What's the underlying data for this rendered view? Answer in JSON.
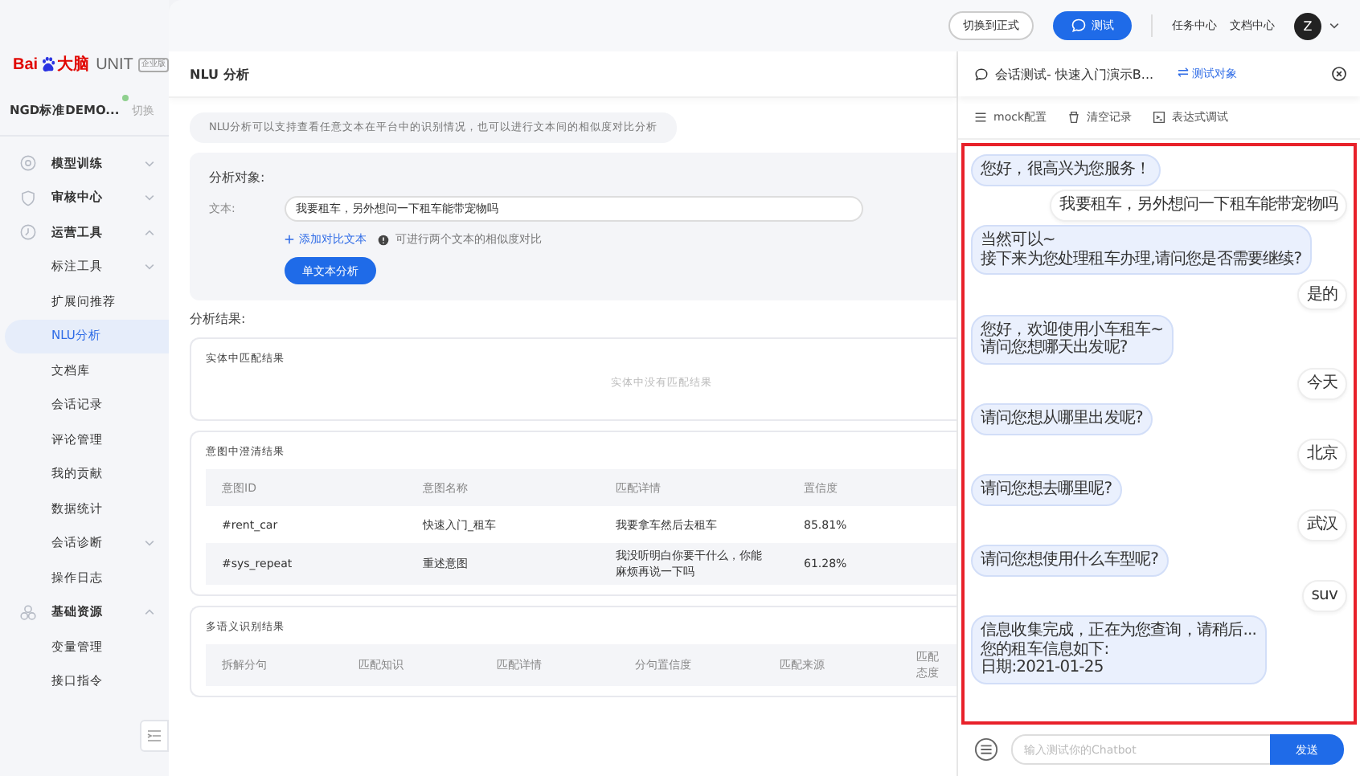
{
  "sidebar": {
    "logo": {
      "left": "Bai",
      "right": "大脑",
      "product": "UNIT",
      "badge": "企业版"
    },
    "project": {
      "name": "NGD标准DEMO...",
      "switch": "切换"
    },
    "menu": [
      {
        "label": "模型训练",
        "kind": "training",
        "expanded": false
      },
      {
        "label": "审核中心",
        "kind": "review",
        "expanded": false
      },
      {
        "label": "运营工具",
        "kind": "operations",
        "expanded": true,
        "children": [
          {
            "label": "标注工具",
            "kind": "group",
            "expanded": false,
            "selected": false
          },
          {
            "label": "扩展问推荐",
            "kind": "page",
            "selected": false
          },
          {
            "label": "NLU分析",
            "kind": "page",
            "selected": true
          },
          {
            "label": "文档库",
            "kind": "page",
            "selected": false
          },
          {
            "label": "会话记录",
            "kind": "page",
            "selected": false
          },
          {
            "label": "评论管理",
            "kind": "page",
            "selected": false
          },
          {
            "label": "我的贡献",
            "kind": "page",
            "selected": false
          },
          {
            "label": "数据统计",
            "kind": "page",
            "selected": false
          },
          {
            "label": "会话诊断",
            "kind": "group",
            "expanded": false,
            "selected": false
          },
          {
            "label": "操作日志",
            "kind": "page",
            "selected": false
          }
        ]
      },
      {
        "label": "基础资源",
        "kind": "resources",
        "expanded": true,
        "children": [
          {
            "label": "变量管理",
            "kind": "page",
            "selected": false
          },
          {
            "label": "接口指令",
            "kind": "page",
            "selected": false
          }
        ]
      }
    ]
  },
  "topbar": {
    "switch_button": "切换到正式",
    "test_button": "测试",
    "links": [
      "任务中心",
      "文档中心"
    ],
    "avatar": "Z"
  },
  "main": {
    "title": "NLU 分析",
    "description": "NLU分析可以支持查看任意文本在平台中的识别情况，也可以进行文本间的相似度对比分析",
    "analysis": {
      "heading": "分析对象:",
      "text_label": "文本:",
      "text_value": "我要租车，另外想问一下租车能带宠物吗",
      "add_link": "添加对比文本",
      "hint": "可进行两个文本的相似度对比",
      "button": "单文本分析"
    },
    "results_heading": "分析结果:",
    "entity_card": {
      "title": "实体中匹配结果",
      "empty": "实体中没有匹配结果"
    },
    "intent_card": {
      "title": "意图中澄清结果",
      "columns": [
        "意图ID",
        "意图名称",
        "匹配详情",
        "置信度"
      ],
      "rows": [
        [
          "#rent_car",
          "快速入门_租车",
          "我要拿车然后去租车",
          "85.81%"
        ],
        [
          "#sys_repeat",
          "重述意图",
          "我没听明白你要干什么，你能麻烦再说一下吗",
          "61.28%"
        ]
      ]
    },
    "multi_card": {
      "title": "多语义识别结果",
      "columns": [
        "拆解分句",
        "匹配知识",
        "匹配详情",
        "分句置信度",
        "匹配来源",
        "匹配态度"
      ]
    }
  },
  "chat": {
    "title": "会话测试- 快速入门演示B...",
    "switch": "测试对象",
    "tools": [
      {
        "kind": "list",
        "label": "mock配置"
      },
      {
        "kind": "clear",
        "label": "清空记录"
      },
      {
        "kind": "debug",
        "label": "表达式调试"
      }
    ],
    "messages": [
      {
        "kind": "bot",
        "lines": [
          "您好，很高兴为您服务！"
        ]
      },
      {
        "kind": "user",
        "lines": [
          "我要租车，另外想问一下租车能带宠物吗"
        ]
      },
      {
        "kind": "bot",
        "lines": [
          "当然可以~",
          "接下来为您处理租车办理,请问您是否需要继续?"
        ]
      },
      {
        "kind": "user",
        "lines": [
          "是的"
        ]
      },
      {
        "kind": "bot",
        "lines": [
          "您好，欢迎使用小车租车~",
          "请问您想哪天出发呢?"
        ]
      },
      {
        "kind": "user",
        "lines": [
          "今天"
        ]
      },
      {
        "kind": "bot",
        "lines": [
          "请问您想从哪里出发呢?"
        ]
      },
      {
        "kind": "user",
        "lines": [
          "北京"
        ]
      },
      {
        "kind": "bot",
        "lines": [
          "请问您想去哪里呢?"
        ]
      },
      {
        "kind": "user",
        "lines": [
          "武汉"
        ]
      },
      {
        "kind": "bot",
        "lines": [
          "请问您想使用什么车型呢?"
        ]
      },
      {
        "kind": "user",
        "lines": [
          "suv"
        ]
      },
      {
        "kind": "bot",
        "lines": [
          "信息收集完成，正在为您查询，请稍后...",
          "您的租车信息如下:",
          "日期:2021-01-25"
        ]
      }
    ],
    "input_placeholder": "输入测试你的Chatbot",
    "send": "发送"
  }
}
